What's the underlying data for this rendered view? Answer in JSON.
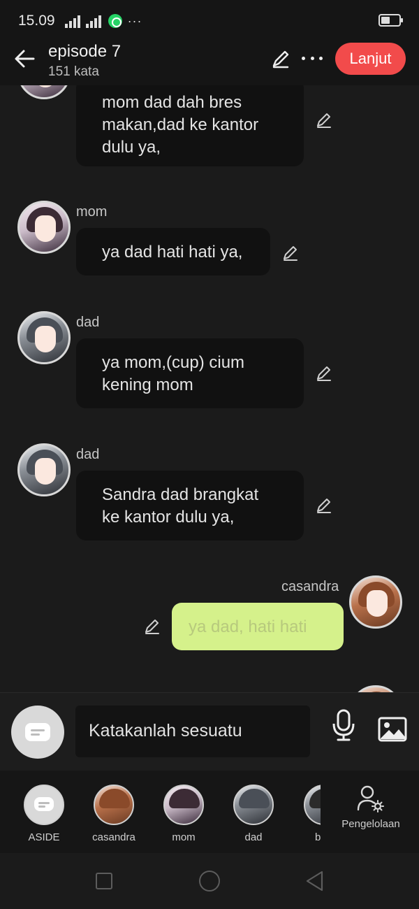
{
  "status_bar": {
    "time": "15.09",
    "network": "4G",
    "overflow": "···"
  },
  "header": {
    "title": "episode 7",
    "subtitle": "151 kata",
    "next_button": "Lanjut"
  },
  "chat": {
    "messages": [
      {
        "sender": "",
        "text": "mom dad dah bres\nmakan,dad ke kantor\ndulu ya,",
        "side": "left"
      },
      {
        "sender": "mom",
        "text": "ya dad hati hati ya,",
        "side": "left"
      },
      {
        "sender": "dad",
        "text": "ya mom,(cup) cium\nkening mom",
        "side": "left"
      },
      {
        "sender": "dad",
        "text": "Sandra dad brangkat\nke kantor dulu ya,",
        "side": "left"
      },
      {
        "sender": "casandra",
        "text": "ya dad, hati hati",
        "side": "right"
      }
    ]
  },
  "composer": {
    "placeholder": "Katakanlah sesuatu"
  },
  "characters": [
    {
      "label": "ASIDE"
    },
    {
      "label": "casandra"
    },
    {
      "label": "mom"
    },
    {
      "label": "dad"
    },
    {
      "label": "b"
    }
  ],
  "manage": {
    "label": "Pengelolaan"
  },
  "colors": {
    "accent": "#f24b4b",
    "my_bubble": "#d5f18b",
    "background": "#1b1b1b",
    "bubble": "#111111"
  }
}
